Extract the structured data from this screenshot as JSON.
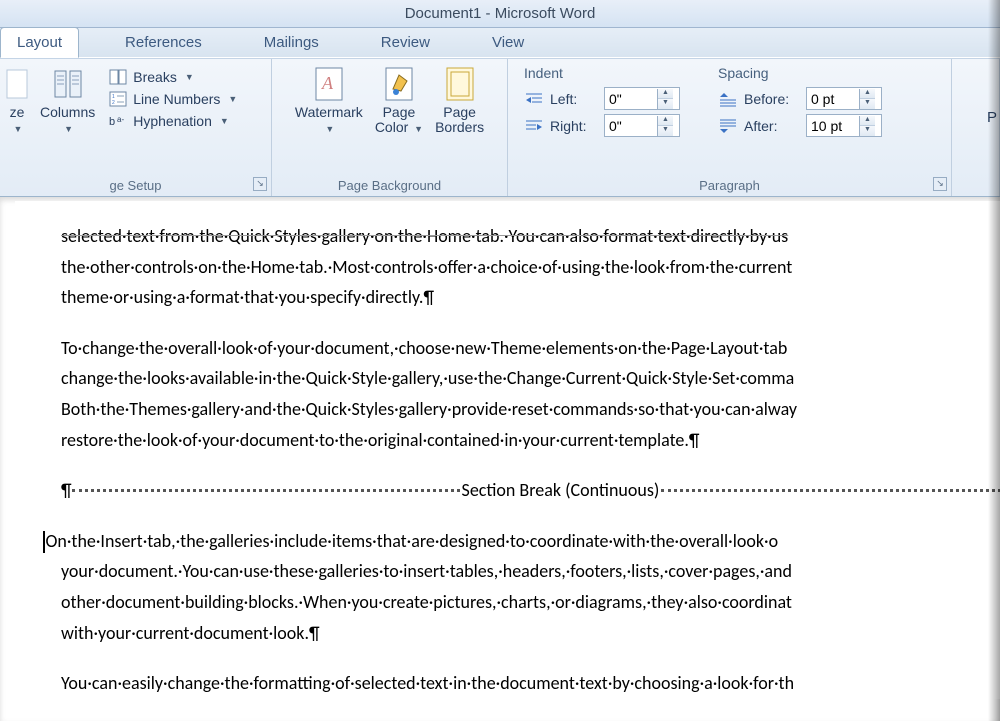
{
  "title": "Document1  -  Microsoft Word",
  "tabs": {
    "layout": "Layout",
    "references": "References",
    "mailings": "Mailings",
    "review": "Review",
    "view": "View"
  },
  "groups": {
    "page_setup": "ge Setup",
    "page_background": "Page Background",
    "paragraph": "Paragraph"
  },
  "btns": {
    "size": "ze",
    "columns": "Columns",
    "breaks": "Breaks",
    "line_numbers": "Line Numbers",
    "hyphenation": "Hyphenation",
    "watermark": "Watermark",
    "page_color": "Page Color",
    "page_borders": "Page\nBorders"
  },
  "paragraph": {
    "indent_label": "Indent",
    "spacing_label": "Spacing",
    "left_label": "Left:",
    "right_label": "Right:",
    "before_label": "Before:",
    "after_label": "After:",
    "left_val": "0\"",
    "right_val": "0\"",
    "before_val": "0 pt",
    "after_val": "10 pt"
  },
  "extra_p": "P",
  "doc": {
    "p0": "selected·text·from·the·Quick·Styles·gallery·on·the·Home·tab.·You·can·also·format·text·directly·by·us",
    "p1": "the·other·controls·on·the·Home·tab.·Most·controls·offer·a·choice·of·using·the·look·from·the·current",
    "p2": "theme·or·using·a·format·that·you·specify·directly.¶",
    "p3": "To·change·the·overall·look·of·your·document,·choose·new·Theme·elements·on·the·Page·Layout·tab",
    "p4": "change·the·looks·available·in·the·Quick·Style·gallery,·use·the·Change·Current·Quick·Style·Set·comma",
    "p5": "Both·the·Themes·gallery·and·the·Quick·Styles·gallery·provide·reset·commands·so·that·you·can·alway",
    "p6": "restore·the·look·of·your·document·to·the·original·contained·in·your·current·template.¶",
    "sb_mark": "¶",
    "sb_label": "Section Break (Continuous)",
    "p7": "On·the·Insert·tab,·the·galleries·include·items·that·are·designed·to·coordinate·with·the·overall·look·o",
    "p8": "your·document.·You·can·use·these·galleries·to·insert·tables,·headers,·footers,·lists,·cover·pages,·and",
    "p9": "other·document·building·blocks.·When·you·create·pictures,·charts,·or·diagrams,·they·also·coordinat",
    "p10": "with·your·current·document·look.¶",
    "p11": "You·can·easily·change·the·formatting·of·selected·text·in·the·document·text·by·choosing·a·look·for·th"
  }
}
